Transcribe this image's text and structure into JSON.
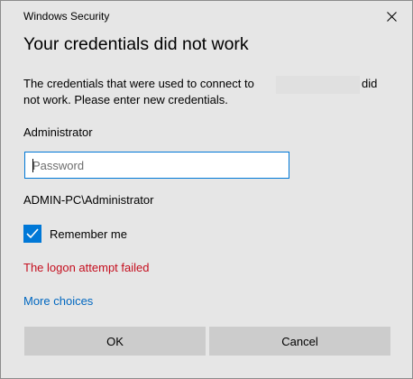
{
  "window": {
    "title": "Windows Security",
    "close_icon": "close-icon"
  },
  "dialog": {
    "heading": "Your credentials did not work",
    "message_line1_start": "The credentials that were used to connect to",
    "message_line1_end": "did",
    "message_line2": "not work. Please enter new credentials.",
    "username": "Administrator",
    "password": {
      "value": "",
      "placeholder": "Password"
    },
    "domain_user": "ADMIN-PC\\Administrator",
    "remember_me": {
      "label": "Remember me",
      "checked": true
    },
    "error": "The logon attempt failed",
    "more_choices": "More choices"
  },
  "buttons": {
    "ok": "OK",
    "cancel": "Cancel"
  },
  "colors": {
    "accent": "#0078d7",
    "error": "#c50f1f",
    "link": "#0067c0",
    "background": "#e6e6e6"
  }
}
